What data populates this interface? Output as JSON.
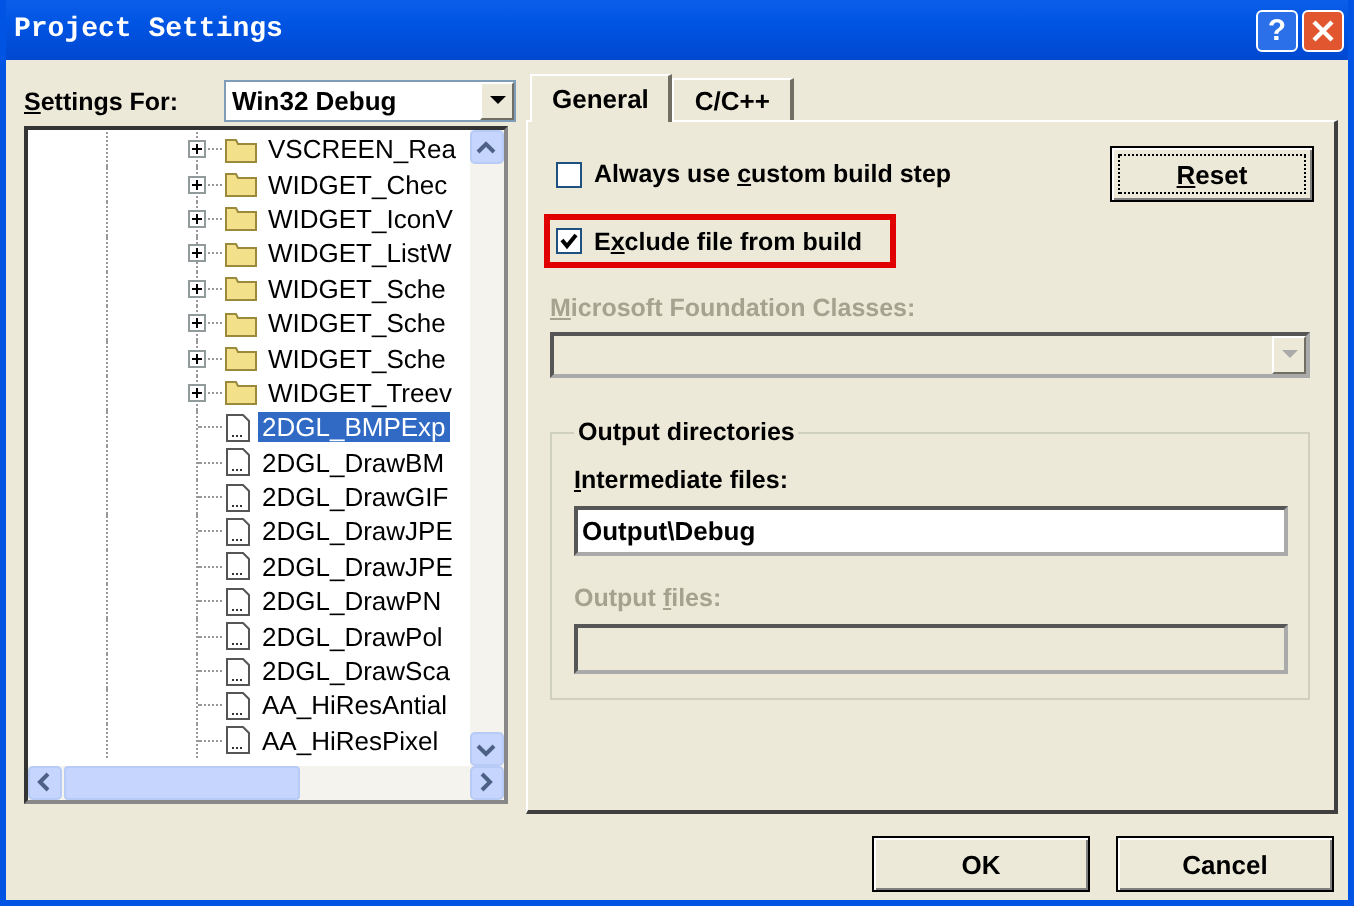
{
  "window": {
    "title": "Project Settings",
    "help_button": "?"
  },
  "settings_for": {
    "label": {
      "key": "S",
      "post": "ettings For:"
    },
    "value": "Win32 Debug"
  },
  "tree": {
    "items": [
      {
        "kind": "folder",
        "label": "VSCREEN_Rea",
        "expanded": false,
        "selected": false
      },
      {
        "kind": "folder",
        "label": "WIDGET_Chec",
        "expanded": false,
        "selected": false
      },
      {
        "kind": "folder",
        "label": "WIDGET_IconV",
        "expanded": false,
        "selected": false
      },
      {
        "kind": "folder",
        "label": "WIDGET_ListW",
        "expanded": false,
        "selected": false
      },
      {
        "kind": "folder",
        "label": "WIDGET_Sche",
        "expanded": false,
        "selected": false
      },
      {
        "kind": "folder",
        "label": "WIDGET_Sche",
        "expanded": false,
        "selected": false
      },
      {
        "kind": "folder",
        "label": "WIDGET_Sche",
        "expanded": false,
        "selected": false
      },
      {
        "kind": "folder",
        "label": "WIDGET_Treev",
        "expanded": false,
        "selected": false
      },
      {
        "kind": "file",
        "label": "2DGL_BMPExp",
        "selected": true
      },
      {
        "kind": "file",
        "label": "2DGL_DrawBM",
        "selected": false
      },
      {
        "kind": "file",
        "label": "2DGL_DrawGIF",
        "selected": false
      },
      {
        "kind": "file",
        "label": "2DGL_DrawJPE",
        "selected": false
      },
      {
        "kind": "file",
        "label": "2DGL_DrawJPE",
        "selected": false
      },
      {
        "kind": "file",
        "label": "2DGL_DrawPN",
        "selected": false
      },
      {
        "kind": "file",
        "label": "2DGL_DrawPol",
        "selected": false
      },
      {
        "kind": "file",
        "label": "2DGL_DrawSca",
        "selected": false
      },
      {
        "kind": "file",
        "label": "AA_HiResAntial",
        "selected": false
      },
      {
        "kind": "file",
        "label": "AA_HiResPixel",
        "selected": false
      }
    ]
  },
  "tabs": [
    {
      "label": "General",
      "selected": true
    },
    {
      "label": "C/C++",
      "selected": false
    }
  ],
  "general": {
    "checkboxes": [
      {
        "label": {
          "pre": "Always use ",
          "key": "c",
          "post": "ustom build step"
        },
        "checked": false,
        "highlighted": false
      },
      {
        "label": {
          "pre": "E",
          "key": "x",
          "post": "clude file from build"
        },
        "checked": true,
        "highlighted": true
      }
    ],
    "reset_button": {
      "key": "R",
      "post": "eset"
    },
    "mfc": {
      "label": {
        "key": "M",
        "post": "icrosoft Foundation Classes:"
      },
      "disabled": true
    },
    "output_directories": {
      "title": "Output directories",
      "fields": [
        {
          "label": {
            "key": "I",
            "post": "ntermediate files:"
          },
          "value": "Output\\Debug",
          "disabled": false
        },
        {
          "label": {
            "pre": "Output ",
            "key": "f",
            "post": "iles:"
          },
          "disabled": true
        }
      ]
    }
  },
  "buttons": [
    {
      "label": "OK"
    },
    {
      "label": "Cancel"
    }
  ]
}
